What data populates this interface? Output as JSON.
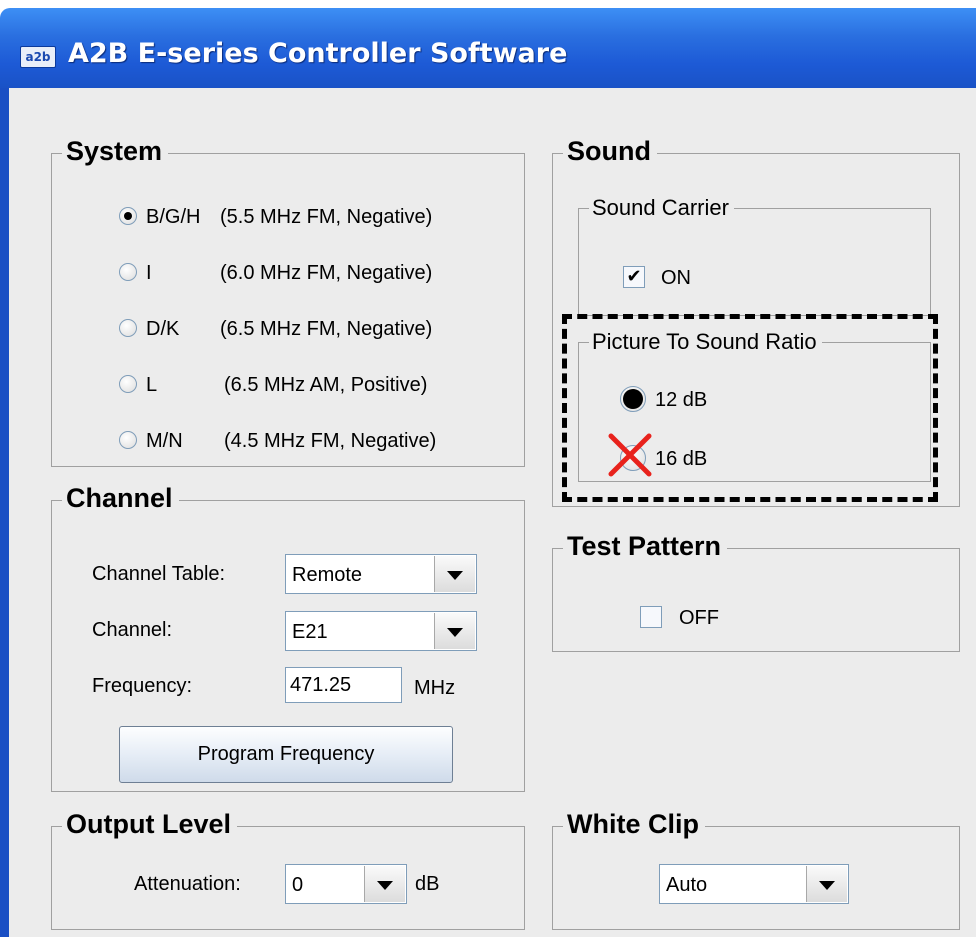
{
  "window": {
    "icon_text": "a2b",
    "title": "A2B E-series Controller Software"
  },
  "system": {
    "legend": "System",
    "options": [
      {
        "code": "B/G/H",
        "desc": "(5.5 MHz FM, Negative)",
        "selected": true
      },
      {
        "code": "I",
        "desc": "(6.0 MHz FM, Negative)",
        "selected": false
      },
      {
        "code": "D/K",
        "desc": "(6.5 MHz FM, Negative)",
        "selected": false
      },
      {
        "code": "L",
        "desc": "(6.5 MHz AM, Positive)",
        "selected": false
      },
      {
        "code": "M/N",
        "desc": "(4.5 MHz FM, Negative)",
        "selected": false
      }
    ]
  },
  "channel": {
    "legend": "Channel",
    "table_label": "Channel Table:",
    "table_value": "Remote",
    "channel_label": "Channel:",
    "channel_value": "E21",
    "frequency_label": "Frequency:",
    "frequency_value": "471.25",
    "frequency_unit": "MHz",
    "program_button": "Program Frequency"
  },
  "output_level": {
    "legend": "Output Level",
    "attenuation_label": "Attenuation:",
    "attenuation_value": "0",
    "attenuation_unit": "dB"
  },
  "sound": {
    "legend": "Sound",
    "carrier_legend": "Sound Carrier",
    "carrier_label": "ON",
    "carrier_checked": true,
    "ratio_legend": "Picture To Sound Ratio",
    "ratio_options": [
      {
        "label": "12 dB",
        "selected": true
      },
      {
        "label": "16 dB",
        "selected": false
      }
    ]
  },
  "test_pattern": {
    "legend": "Test Pattern",
    "label": "OFF",
    "checked": false
  },
  "white_clip": {
    "legend": "White Clip",
    "value": "Auto"
  },
  "annotation": {
    "highlight_color": "#000000",
    "x_mark_color": "#e8221c"
  }
}
